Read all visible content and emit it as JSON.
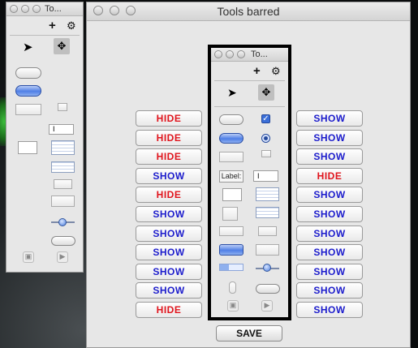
{
  "left_palette": {
    "title": "To..."
  },
  "main_window": {
    "title": "Tools barred"
  },
  "inner_palette": {
    "title": "To..."
  },
  "left_buttons": [
    "HIDE",
    "HIDE",
    "HIDE",
    "SHOW",
    "HIDE",
    "SHOW",
    "SHOW",
    "SHOW",
    "SHOW",
    "SHOW",
    "HIDE"
  ],
  "right_buttons": [
    "SHOW",
    "SHOW",
    "SHOW",
    "HIDE",
    "SHOW",
    "SHOW",
    "SHOW",
    "SHOW",
    "SHOW",
    "SHOW",
    "SHOW"
  ],
  "save_label": "SAVE",
  "inner_label_tool": "Label:",
  "colors": {
    "hide": "#e0141c",
    "show": "#1c1ccc"
  },
  "icons": [
    "plus-icon",
    "gear-icon",
    "arrow-pointer-icon",
    "move-cursor-icon"
  ]
}
